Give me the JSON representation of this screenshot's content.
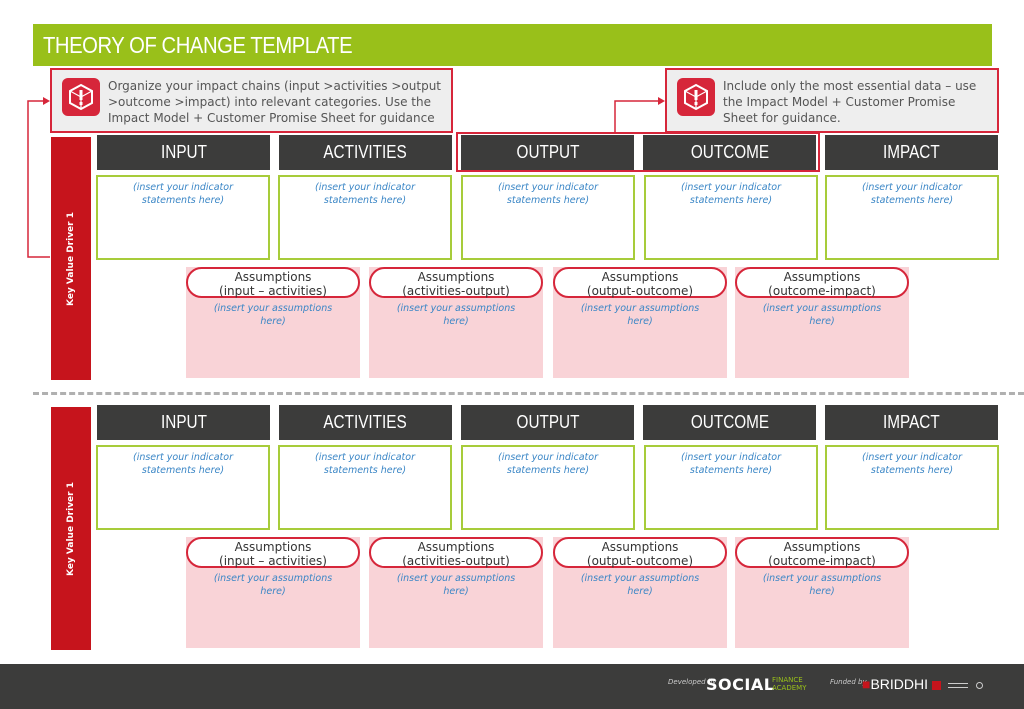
{
  "title": "THEORY OF CHANGE TEMPLATE",
  "notes": {
    "left": "Organize your impact chains (input >activities >output >outcome >impact) into relevant categories. Use the Impact Model + Customer Promise Sheet for guidance",
    "right": "Include only the most essential data – use the Impact Model + Customer Promise Sheet for guidance.",
    "icon": "alert-cube-icon"
  },
  "columns": [
    "INPUT",
    "ACTIVITIES",
    "OUTPUT",
    "OUTCOME",
    "IMPACT"
  ],
  "indicator_placeholder": "(insert your indicator statements here)",
  "assumptions": [
    {
      "title": "Assumptions",
      "sub": "(input – activities)"
    },
    {
      "title": "Assumptions",
      "sub": "(activities-output)"
    },
    {
      "title": "Assumptions",
      "sub": "(output-outcome)"
    },
    {
      "title": "Assumptions",
      "sub": "(outcome-impact)"
    }
  ],
  "assumption_placeholder": "(insert your assumptions here)",
  "sections": [
    {
      "driver_label": "Key Value Driver 1"
    },
    {
      "driver_label": "Key Value Driver 1"
    }
  ],
  "footer": {
    "developed_by": "Developed by",
    "social": "SOCIAL",
    "finance_academy": "FINANCE ACADEMY",
    "funded_by": "Funded by",
    "briddhi": "BRIDDHI"
  },
  "colors": {
    "green": "#99c01a",
    "red": "#c6141c",
    "dark": "#3c3c3b",
    "pink": "#f9d3d7",
    "blue_text": "#3a86c6"
  }
}
